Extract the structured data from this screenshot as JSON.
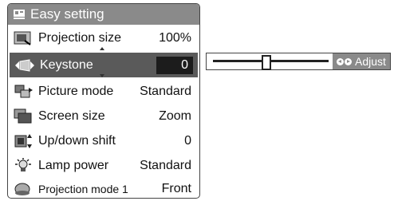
{
  "header": {
    "title": "Easy setting",
    "icon": "easy-setting-icon"
  },
  "menu": {
    "items": [
      {
        "label": "Projection size",
        "value": "100%",
        "icon": "projection-size-icon"
      },
      {
        "label": "Keystone",
        "value": "0",
        "icon": "keystone-icon"
      },
      {
        "label": "Picture mode",
        "value": "Standard",
        "icon": "picture-mode-icon"
      },
      {
        "label": "Screen size",
        "value": "Zoom",
        "icon": "screen-size-icon"
      },
      {
        "label": "Up/down shift",
        "value": "0",
        "icon": "up-down-shift-icon"
      },
      {
        "label": "Lamp power",
        "value": "Standard",
        "icon": "lamp-power-icon"
      },
      {
        "label": "Projection mode 1",
        "value": "Front",
        "icon": "projection-mode-icon"
      }
    ],
    "selected_index": 1
  },
  "adjust_slider": {
    "label": "Adjust",
    "level": 0.46,
    "icon": "left-right-arrows-icon"
  },
  "colors": {
    "header_bg": "#8a8a8a",
    "selected_bg": "#5a5a5a",
    "value_bg": "#1c1c1c"
  }
}
